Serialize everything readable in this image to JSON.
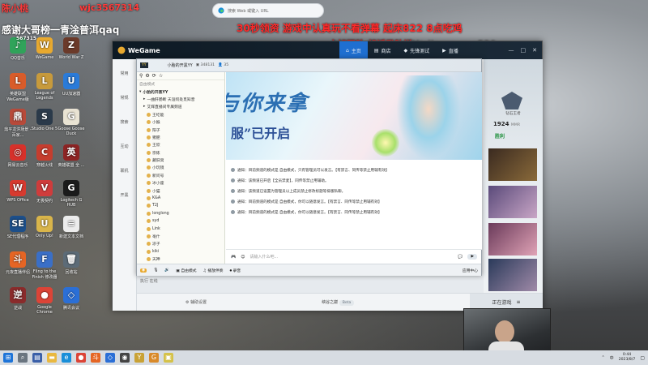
{
  "overlay": {
    "top_left_a": "陈小桃",
    "top_left_b": "wjc3567314",
    "left_line": "感谢大哥榜一青淦普洱qaq",
    "left_num": "567315",
    "red_line": "30秒领资 游戏中认真玩不看弹幕 起床822 8点吃鸡",
    "red_line2": "卡好团队·想活登队增Y：jingyuque520",
    "colors": {
      "red": "#ff2a2a",
      "white": "#ffffff"
    }
  },
  "search_popup": {
    "placeholder": "搜索 Web 或键入 URL",
    "icon": "edge-icon"
  },
  "desktop_icons": [
    {
      "label": "QQ音乐",
      "color": "#30a35a",
      "glyph": "♪"
    },
    {
      "label": "WeGame",
      "color": "#e8a92f",
      "glyph": "W"
    },
    {
      "label": "World War Z",
      "color": "#6b3a2a",
      "glyph": "Z"
    },
    {
      "label": "英雄联盟WeGame版",
      "color": "#d95c2a",
      "glyph": "L"
    },
    {
      "label": "League of Legends",
      "color": "#c79a3c",
      "glyph": "L"
    },
    {
      "label": "UU加速器",
      "color": "#2a7bd9",
      "glyph": "U"
    },
    {
      "label": "鼎平龙洪场景 - 百家...",
      "color": "#b74a3a",
      "glyph": "鼎"
    },
    {
      "label": "Studio One 5",
      "color": "#2b3a4a",
      "glyph": "S"
    },
    {
      "label": "Goose Goose Duck",
      "color": "#e9e3d3",
      "glyph": "G"
    },
    {
      "label": "网易云音乐",
      "color": "#d7312a",
      "glyph": "◎"
    },
    {
      "label": "穿越火线",
      "color": "#c53d2e",
      "glyph": "C"
    },
    {
      "label": "英雄联盟 全 ...",
      "color": "#8d2424",
      "glyph": "英"
    },
    {
      "label": "WPS Office",
      "color": "#d73a2f",
      "glyph": "W"
    },
    {
      "label": "无畏契约",
      "color": "#cf3c3c",
      "glyph": "V"
    },
    {
      "label": "Logitech G HUB",
      "color": "#1b1b1b",
      "glyph": "G"
    },
    {
      "label": "SE代理程序",
      "color": "#1d4f8a",
      "glyph": "SE"
    },
    {
      "label": "Only Up!",
      "color": "#d9b54a",
      "glyph": "U"
    },
    {
      "label": "新建文本文档",
      "color": "#ececec",
      "glyph": "≡"
    },
    {
      "label": "元夜直播伴侣",
      "color": "#e56524",
      "glyph": "斗"
    },
    {
      "label": "Fling to the Finish 修改器",
      "color": "#3a6fc7",
      "glyph": "F"
    },
    {
      "label": "回收站",
      "color": "#5c6b77",
      "glyph": "🗑"
    },
    {
      "label": "逆战",
      "color": "#8a2b2b",
      "glyph": "逆"
    },
    {
      "label": "Google Chrome",
      "color": "#dc4437",
      "glyph": "●"
    },
    {
      "label": "腾讯会议",
      "color": "#2b6fd6",
      "glyph": "◇"
    }
  ],
  "wegame": {
    "brand": "WeGame",
    "nav": [
      "主页",
      "商店",
      "先锋测试",
      "直播"
    ],
    "active_nav": 0,
    "sidebar_items": [
      "常用",
      "常规",
      "搜索",
      "互动",
      "联机",
      "开黑"
    ],
    "right_panel": {
      "rank": "钻石王者",
      "mmr": "1924",
      "mmr_unit": "MMR",
      "status": "胜利"
    },
    "bottom": {
      "settings": "辅助设置",
      "mode": "峡谷之巅",
      "mode_tag": "Beta",
      "queue": "正在游戏"
    },
    "left_chat": "执行 在线"
  },
  "yy": {
    "title": "小胎的开黑YY",
    "id": "348131",
    "online": "35",
    "tab_voice": "自由模式",
    "channel": "小胎的开黑YY",
    "sub_channels": [
      "一曲肝肠断 天涯何处觅知音",
      "艾辉直播间专属频道"
    ],
    "members": [
      "王屹能",
      "小猴",
      "阳子",
      "猪肥",
      "王欣",
      "宗炼",
      "藏旧窝",
      "小玩镜",
      "新问号",
      "冰小座",
      "小猫",
      "K&A",
      "T2J",
      "longlong",
      "syd",
      "Link",
      "毫什",
      "凉子",
      "kiki",
      "天神"
    ],
    "logs": [
      "通知：目前频道的模式是 自由模式，只有管理员可以发言。【有禁言、同传等禁止用辅有效】",
      "通知：该频道已开启【全员禁麦】，同传等禁止用辅助。",
      "通知：该频道已设置为管理员以上成员禁止修改标题等排版私聊。",
      "通知：目前频道的模式是 自由模式，你可以随意发言。【有禁言、同传等禁止用辅有效】",
      "通知：目前频道的模式是 自由模式，你可以随意发言。【有禁言、同传等禁止用辅有效】"
    ],
    "input_placeholder": "请输入什么吧...",
    "footer": {
      "mode": "自由模式",
      "extra": "播放伴奏",
      "record": "录音",
      "app": "应用中心"
    },
    "banner_text_1": "与你来拿",
    "banner_text_2": "服”已开启"
  },
  "taskbar": {
    "time": "0:44",
    "date": "2023/8/7",
    "tray": "中"
  }
}
